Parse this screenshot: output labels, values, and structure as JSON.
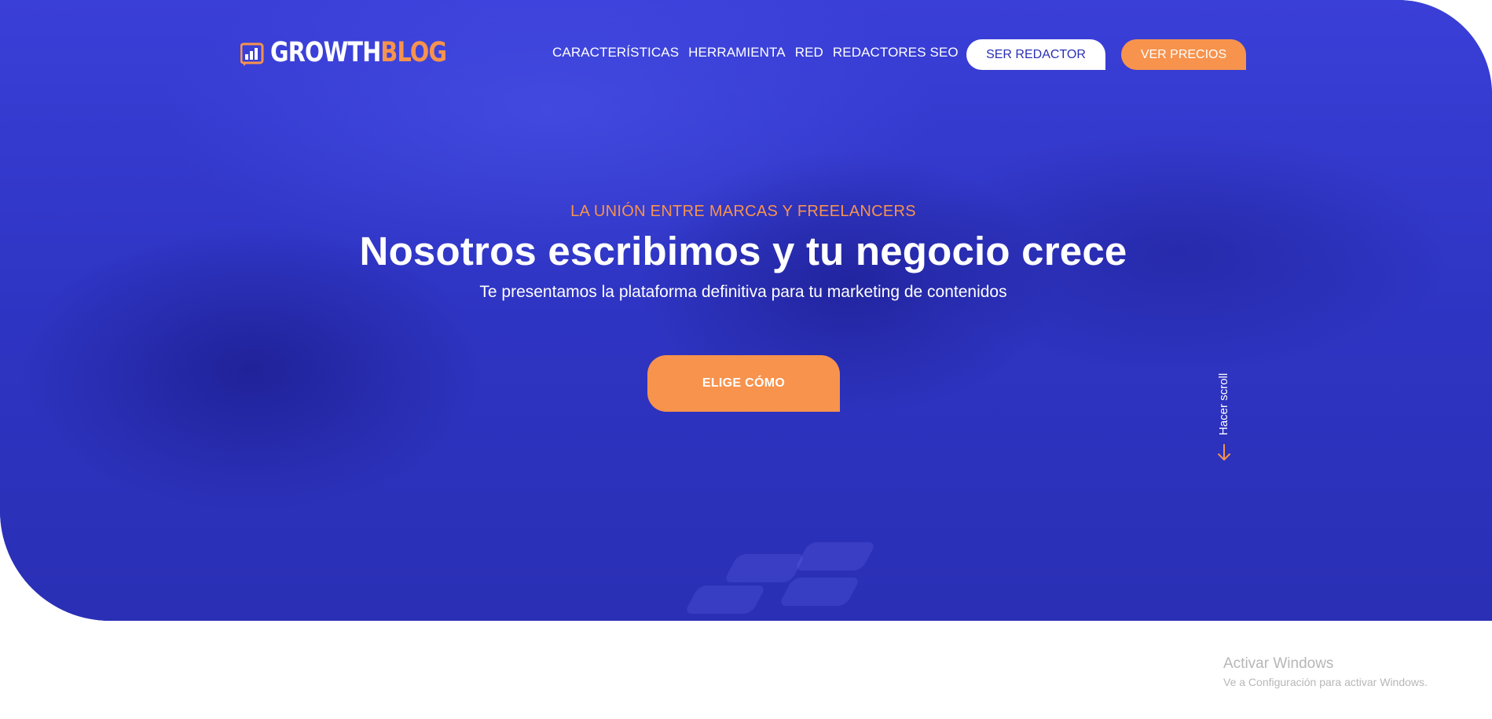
{
  "brand": {
    "logo_white": "GROWTH",
    "logo_orange": "BLOG",
    "primary_color": "#3035c8",
    "accent_color": "#f7934d"
  },
  "nav": {
    "items": [
      {
        "label": "CARACTERÍSTICAS"
      },
      {
        "label": "HERRAMIENTA"
      },
      {
        "label": "RED"
      },
      {
        "label": "REDACTORES SEO"
      }
    ],
    "ser_redactor": "SER REDACTOR",
    "ver_precios": "VER PRECIOS"
  },
  "hero": {
    "eyebrow": "LA UNIÓN ENTRE MARCAS Y FREELANCERS",
    "headline": "Nosotros escribimos y tu negocio crece",
    "subline": "Te presentamos la plataforma definitiva para tu marketing de contenidos",
    "cta": "ELIGE CÓMO",
    "scroll_label": "Hacer scroll",
    "scroll_icon": "arrow-down-icon"
  },
  "watermark": {
    "title": "Activar Windows",
    "subtitle": "Ve a Configuración para activar Windows."
  }
}
